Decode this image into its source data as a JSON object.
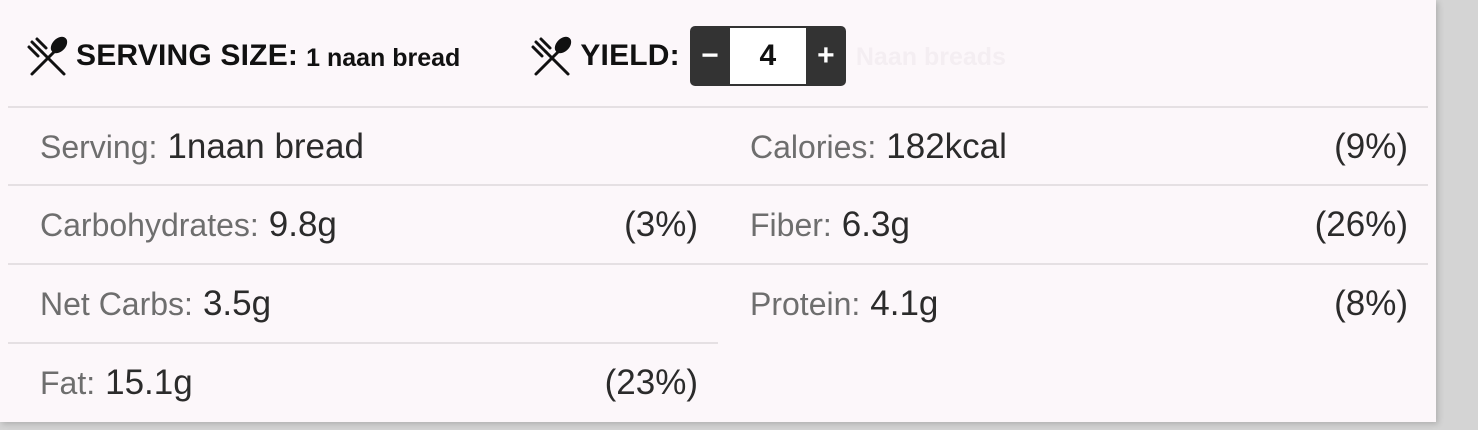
{
  "header": {
    "serving_size_label": "SERVING SIZE:",
    "serving_size_value": "1 naan bread",
    "yield_label": "YIELD:",
    "yield_decrement": "−",
    "yield_value": "4",
    "yield_increment": "+",
    "yield_unit": "Naan breads",
    "icon": "fork-spoon-icon"
  },
  "nutrition": {
    "serving": {
      "label": "Serving:",
      "value": "1naan bread"
    },
    "calories": {
      "label": "Calories:",
      "value": "182kcal",
      "pct": "(9%)"
    },
    "carbohydrates": {
      "label": "Carbohydrates:",
      "value": "9.8g",
      "pct": "(3%)"
    },
    "fiber": {
      "label": "Fiber:",
      "value": "6.3g",
      "pct": "(26%)"
    },
    "net_carbs": {
      "label": "Net Carbs:",
      "value": "3.5g"
    },
    "protein": {
      "label": "Protein:",
      "value": "4.1g",
      "pct": "(8%)"
    },
    "fat": {
      "label": "Fat:",
      "value": "15.1g",
      "pct": "(23%)"
    }
  },
  "colors": {
    "card_background": "#fcf7fa",
    "stepper_background": "#333333",
    "divider": "#e5e0e3",
    "label_text": "#6e6e6e",
    "value_text": "#2b2b2b"
  }
}
